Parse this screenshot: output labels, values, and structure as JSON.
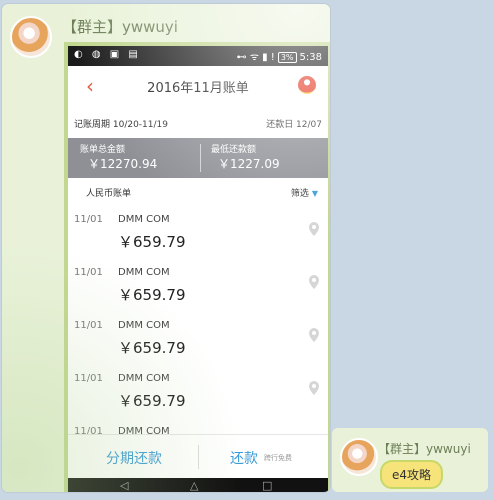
{
  "message1": {
    "sender": "【群主】ywwuyi"
  },
  "phone": {
    "status": {
      "time": "5:38",
      "battery": "3%"
    },
    "title": "2016年11月账单",
    "period": "记账周期 10/20-11/19",
    "due": "还款日 12/07",
    "total_label": "账单总金额",
    "total_value": "￥12270.94",
    "min_label": "最低还款额",
    "min_value": "￥1227.09",
    "currency_tab": "人民币账单",
    "filter": "筛选",
    "transactions": [
      {
        "date": "11/01",
        "merchant": "DMM COM",
        "amount": "￥659.79"
      },
      {
        "date": "11/01",
        "merchant": "DMM COM",
        "amount": "￥659.79"
      },
      {
        "date": "11/01",
        "merchant": "DMM COM",
        "amount": "￥659.79"
      },
      {
        "date": "11/01",
        "merchant": "DMM COM",
        "amount": "￥659.79"
      },
      {
        "date": "11/01",
        "merchant": "DMM COM",
        "amount": ""
      }
    ],
    "installment_btn": "分期还款",
    "repay_btn": "还款",
    "repay_sub": "跨行免费"
  },
  "message2": {
    "sender": "【群主】ywwuyi",
    "text": "e4攻略"
  },
  "colors": {
    "accent": "#3a9bd6",
    "back_arrow": "#e45b3d",
    "summary_bar": "#8f9096",
    "chat_bubble": "#e9f2d9"
  },
  "icons": [
    "back-arrow-icon",
    "logo-icon",
    "filter-triangle-icon",
    "location-pin-icon"
  ]
}
